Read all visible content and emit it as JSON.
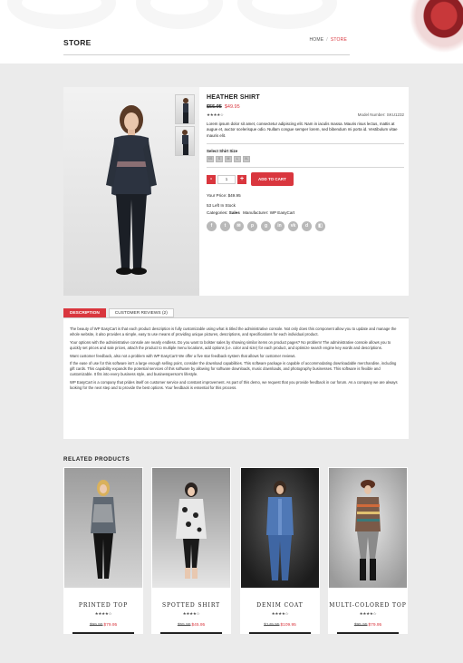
{
  "header": {
    "title": "STORE",
    "breadcrumb": {
      "home": "HOME",
      "separator": "/",
      "current": "STORE"
    }
  },
  "product": {
    "name": "HEATHER SHIRT",
    "old_price": "$55.95",
    "new_price": "$49.95",
    "stars": "★★★★☆",
    "model": "Model Number: SKU1232",
    "short_description": "Lorem ipsum dolor sit amet, consectetur adipiscing elit. Nam in iaculis massa. Mauris risus lectus, mattis at augue et, auctor scelerisque odio. Nullam congue semper lorem, sed bibendum mi porta id. Vestibulum vitae mauris elit.",
    "size_label": "Select Shirt Size",
    "sizes": [
      "XS",
      "S",
      "M",
      "L",
      "XL"
    ],
    "quantity": "1",
    "minus": "-",
    "plus": "+",
    "add_to_cart": "ADD TO CART",
    "your_price": "Your Price: $49.95",
    "stock": "53 Left In Stock",
    "categories_label": "Categories:",
    "categories_value": "Sales",
    "manufacturer_label": "Manufacturer:",
    "manufacturer_value": "WP EasyCart",
    "socials": [
      {
        "icon": "facebook-icon",
        "glyph": "f"
      },
      {
        "icon": "twitter-icon",
        "glyph": "t"
      },
      {
        "icon": "email-icon",
        "glyph": "✉"
      },
      {
        "icon": "pinterest-icon",
        "glyph": "p"
      },
      {
        "icon": "google-plus-icon",
        "glyph": "g"
      },
      {
        "icon": "linkedin-icon",
        "glyph": "in"
      },
      {
        "icon": "vk-icon",
        "glyph": "vk"
      },
      {
        "icon": "digg-icon",
        "glyph": "d"
      },
      {
        "icon": "delicious-icon",
        "glyph": "◧"
      }
    ]
  },
  "tabs": {
    "description": "DESCRIPTION",
    "reviews": "CUSTOMER REVIEWS (2)"
  },
  "description": [
    "The beauty of WP EasyCart is that each product description is fully customizable using what is titled the administrative console. Not only does this component allow you to update and manage the whole website, it also provides a simple, easy to use means of providing unique pictures, descriptions, and specifications for each individual product.",
    "Your options with the administrative console are nearly endless. Do you want to bolster sales by showing similar items on product pages? No problem! The administrative console allows you to quickly set prices and sale prices, attach the product to multiple menu locations, add options (i.e. color and size) for each product, and optimize search engine key words and descriptions.",
    "Want customer feedback, also not a problem with WP EasyCart! We offer a five star feedback system that allows for customer reviews.",
    "If the ease of use for this software isn't a large enough selling point, consider the download capabilities. This software package is capable of accommodating downloadable merchandise, including gift cards. This capability expands the potential services of this software by allowing for software downloads, music downloads, and photography businesses. This software is flexible and customizable. It fits into every business style, and businessperson's lifestyle.",
    "WP EasyCart is a company that prides itself on customer service and constant improvement. As part of this demo, we request that you provide feedback in our forum. As a company we are always looking for the next step and to provide the best options. Your feedback is essential for this process."
  ],
  "related": {
    "title": "RELATED PRODUCTS",
    "items": [
      {
        "name": "PRINTED TOP",
        "stars": "★★★★☆",
        "old_price": "$99.95",
        "new_price": "$79.95"
      },
      {
        "name": "SPOTTED SHIRT",
        "stars": "★★★★☆",
        "old_price": "$55.95",
        "new_price": "$45.95"
      },
      {
        "name": "DENIM COAT",
        "stars": "★★★★☆",
        "old_price": "$149.95",
        "new_price": "$109.95"
      },
      {
        "name": "MULTI-COLORED TOP",
        "stars": "★★★★☆",
        "old_price": "$95.95",
        "new_price": "$79.95"
      }
    ]
  },
  "colors": {
    "accent": "#d9363e",
    "background": "#ebebeb",
    "panel": "#ffffff"
  }
}
